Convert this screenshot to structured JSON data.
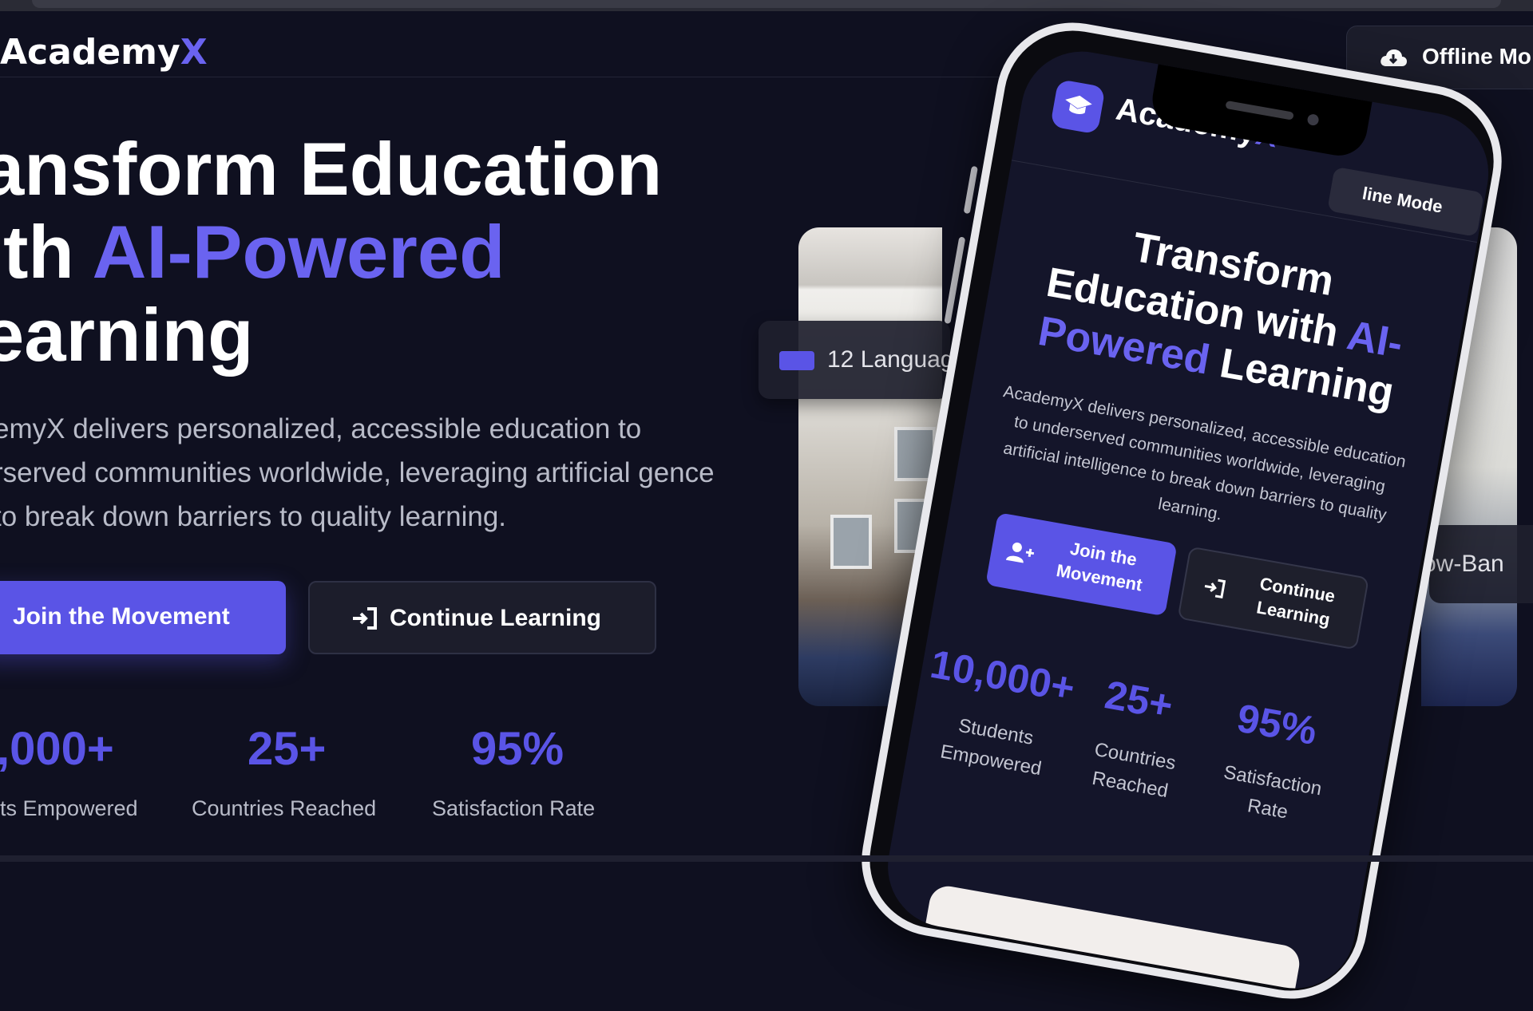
{
  "header": {
    "logo_main": "Academy",
    "logo_accent": "X",
    "offline_label": "Offline Mo"
  },
  "hero": {
    "title_line1": "ansform Education",
    "title_line2_prefix": "ith ",
    "title_line2_accent": "AI-Powered",
    "title_line3": "earning",
    "description": "emyX delivers personalized, accessible education to rserved communities worldwide, leveraging artificial gence to break down barriers to quality learning.",
    "primary_button": "Join the Movement",
    "secondary_button": "Continue Learning"
  },
  "stats": [
    {
      "value": ",000+",
      "label": "ts Empowered"
    },
    {
      "value": "25+",
      "label": "Countries Reached"
    },
    {
      "value": "95%",
      "label": "Satisfaction Rate"
    }
  ],
  "badges": {
    "languages": "12 Languag",
    "low_bandwidth": "ow-Ban"
  },
  "phone": {
    "logo_main": "Academy",
    "logo_accent": "X",
    "offline_label": "line Mode",
    "title_line1": "Transform",
    "title_line2": "Education with ",
    "title_line2_accent": "AI-",
    "title_line3_accent": "Powered",
    "title_line3_suffix": " Learning",
    "description": "AcademyX delivers personalized, accessible education to underserved communities worldwide, leveraging artificial intelligence to break down barriers to quality learning.",
    "primary_button": "Join the Movement",
    "secondary_button": "Continue Learning",
    "stats": [
      {
        "value": "10,000+",
        "label": "Students Empowered"
      },
      {
        "value": "25+",
        "label": "Countries Reached"
      },
      {
        "value": "95%",
        "label": "Satisfaction Rate"
      }
    ]
  },
  "colors": {
    "background": "#0f1020",
    "accent": "#5a54e6",
    "accent_text": "#6a63f0",
    "muted_text": "#b8bbc8"
  },
  "icons": [
    "cloud-download-icon",
    "user-plus-icon",
    "sign-in-icon",
    "language-icon",
    "graduation-cap-icon"
  ]
}
